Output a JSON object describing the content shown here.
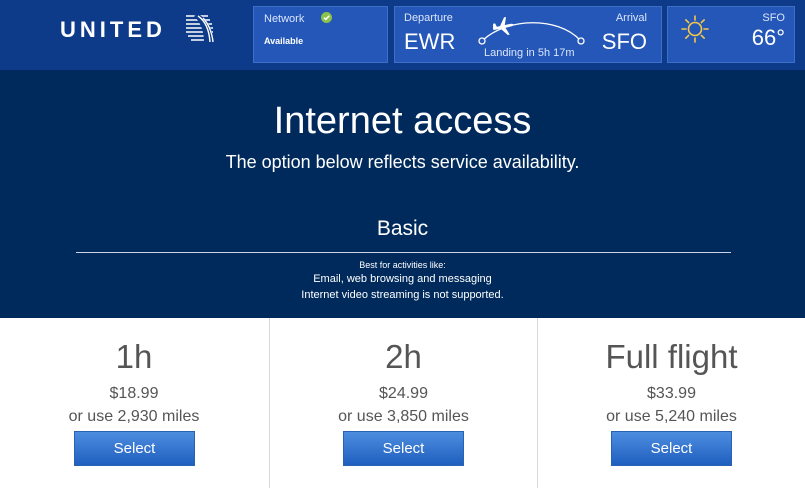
{
  "header": {
    "logo_text": "UNITED",
    "network": {
      "label": "Network",
      "status": "Available",
      "status_icon": "check-circle-icon"
    },
    "flight": {
      "departure_label": "Departure",
      "departure_code": "EWR",
      "arrival_label": "Arrival",
      "arrival_code": "SFO",
      "landing_text": "Landing in 5h 17m"
    },
    "weather": {
      "city": "SFO",
      "temperature": "66°",
      "icon": "sun-icon"
    }
  },
  "hero": {
    "title": "Internet access",
    "subtitle": "The option below reflects service availability.",
    "tier_name": "Basic",
    "best_for": "Best for activities like:",
    "activities": "Email, web browsing and messaging",
    "note": "Internet video streaming is not supported."
  },
  "plans": [
    {
      "duration": "1h",
      "price": "$18.99",
      "miles": "or use 2,930 miles",
      "button": "Select"
    },
    {
      "duration": "2h",
      "price": "$24.99",
      "miles": "or use 3,850 miles",
      "button": "Select"
    },
    {
      "duration": "Full flight",
      "price": "$33.99",
      "miles": "or use 5,240 miles",
      "button": "Select"
    }
  ],
  "colors": {
    "topbar": "#0e3a8a",
    "panel": "#2457b8",
    "hero": "#002a5c",
    "button": "#2a6fd0",
    "status_ok": "#8bc34a"
  }
}
